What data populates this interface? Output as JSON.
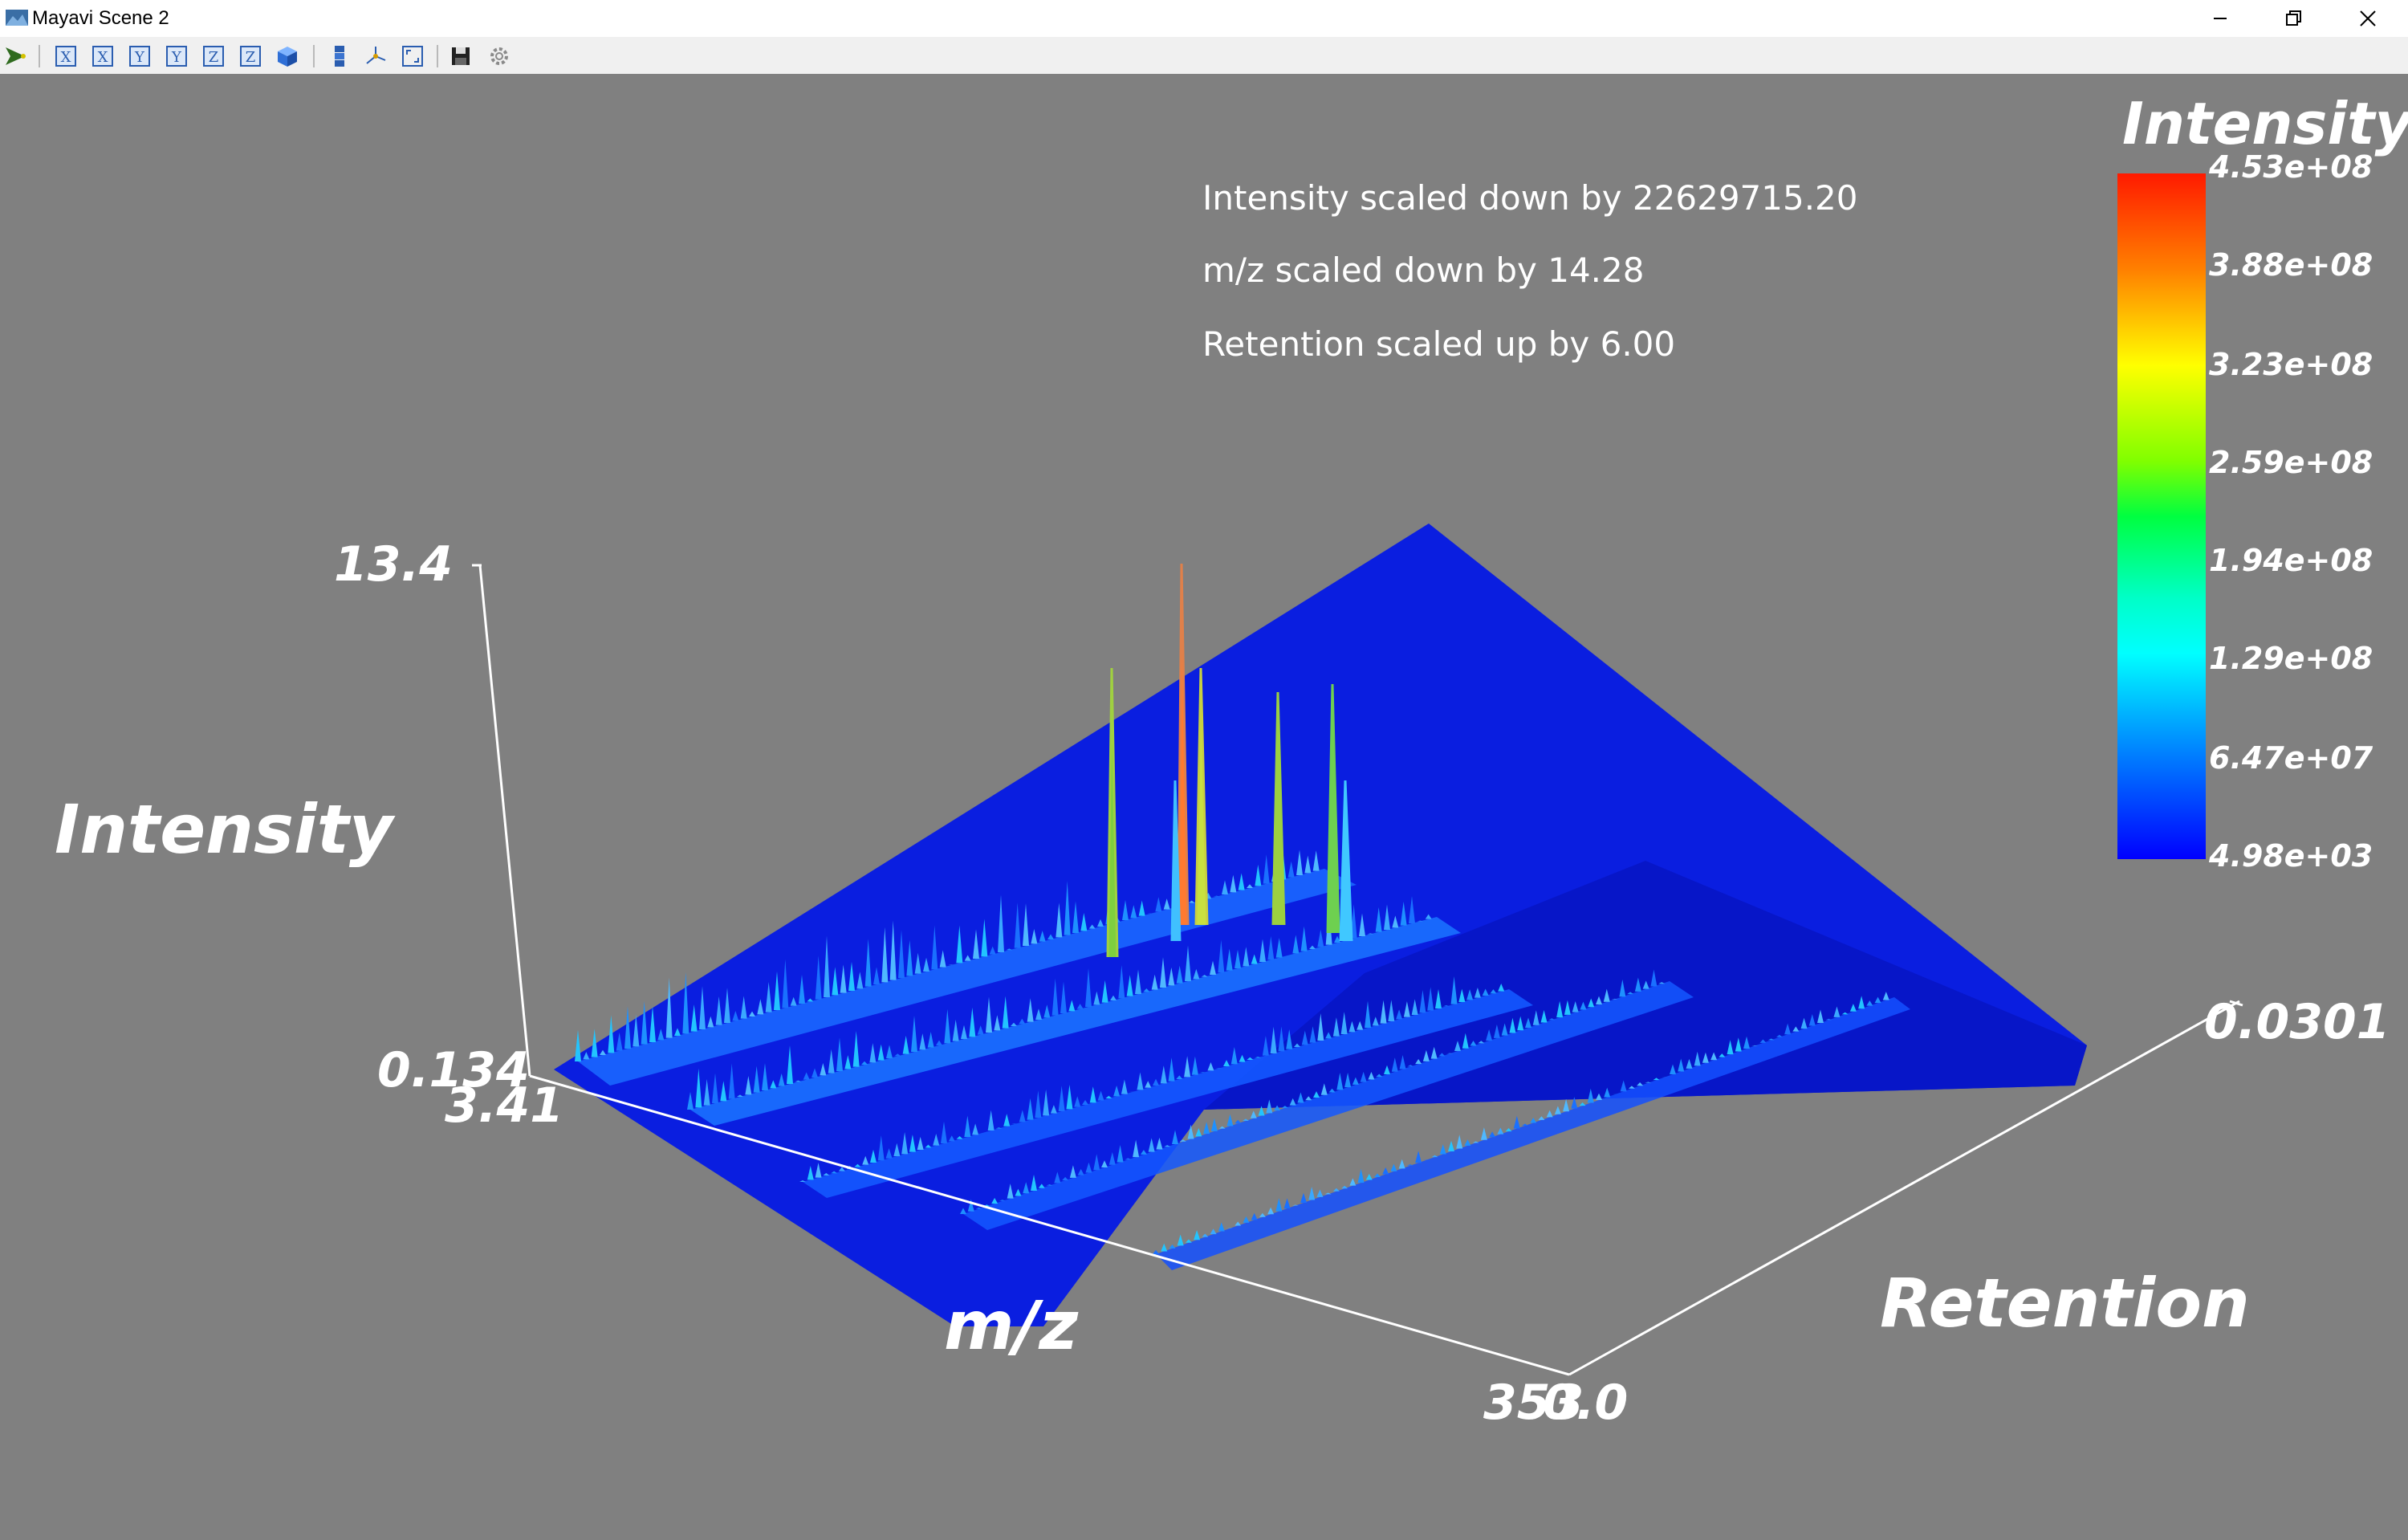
{
  "window": {
    "title": "Mayavi Scene 2",
    "controls": [
      "minimize-icon",
      "restore-icon",
      "close-icon"
    ]
  },
  "toolbar": {
    "buttons": [
      {
        "name": "mayavi-pipeline-icon",
        "glyph": ""
      },
      {
        "name": "view-x-plus-button",
        "glyph": "X"
      },
      {
        "name": "view-x-minus-button",
        "glyph": "X"
      },
      {
        "name": "view-y-plus-button",
        "glyph": "Y"
      },
      {
        "name": "view-y-minus-button",
        "glyph": "Y"
      },
      {
        "name": "view-z-plus-button",
        "glyph": "Z"
      },
      {
        "name": "view-z-minus-button",
        "glyph": "Z"
      },
      {
        "name": "isometric-view-button",
        "glyph": ""
      },
      {
        "name": "parallel-projection-button",
        "glyph": ""
      },
      {
        "name": "axes-indicator-button",
        "glyph": ""
      },
      {
        "name": "full-screen-button",
        "glyph": ""
      },
      {
        "name": "save-scene-button",
        "glyph": ""
      },
      {
        "name": "scene-settings-button",
        "glyph": ""
      }
    ]
  },
  "annotations": {
    "intensity_scale": "Intensity scaled down by 22629715.20",
    "mz_scale": "m/z scaled down by 14.28",
    "retention_scale": "Retention scaled up by 6.00"
  },
  "axes": {
    "intensity_label": "Intensity",
    "mz_label": "m/z",
    "retention_label": "Retention",
    "intensity_max": "13.4",
    "intensity_min": "0.134",
    "mz_min": "3.41",
    "mz_max": "353",
    "retention_min": "0.0",
    "retention_max": "0.0301"
  },
  "colorbar": {
    "title": "Intensity",
    "ticks": [
      "4.53e+08",
      "3.88e+08",
      "3.23e+08",
      "2.59e+08",
      "1.94e+08",
      "1.29e+08",
      "6.47e+07",
      "4.98e+03"
    ],
    "colors": [
      "#ff1a00",
      "#ff8000",
      "#ffff00",
      "#80ff00",
      "#00ff40",
      "#00ffff",
      "#0096ff",
      "#0000ff"
    ]
  },
  "colors": {
    "background": "#808080",
    "surface": "#0a1ee0",
    "axis_line": "#ffffff"
  }
}
